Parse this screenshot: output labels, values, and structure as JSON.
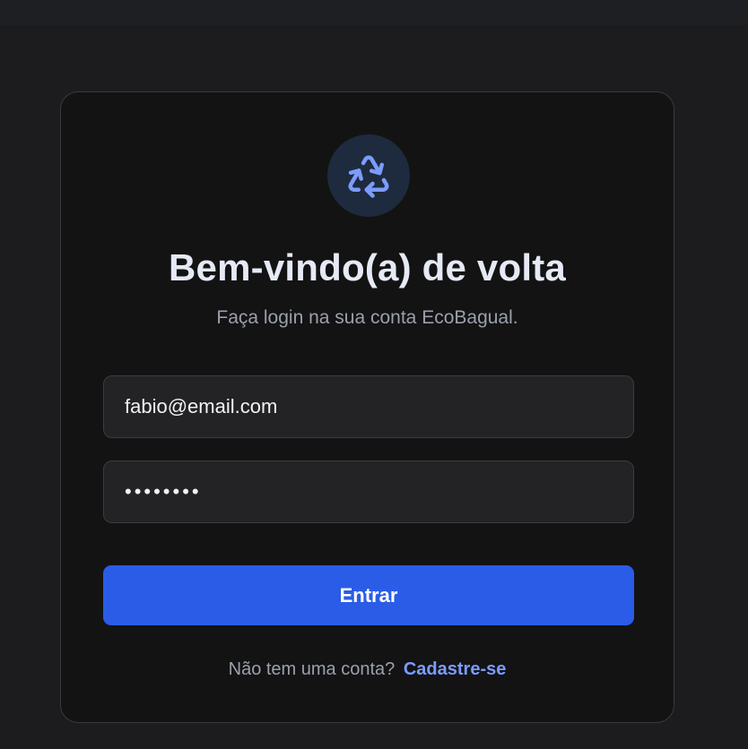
{
  "login": {
    "title": "Bem-vindo(a) de volta",
    "subtitle": "Faça login na sua conta EcoBagual.",
    "email_value": "fabio@email.com",
    "password_value": "••••••••",
    "submit_label": "Entrar",
    "signup_prompt": "Não tem uma conta?",
    "signup_link": "Cadastre-se",
    "logo_icon": "recycle-icon"
  },
  "colors": {
    "accent": "#2a5ce8",
    "link": "#7b9cff",
    "icon": "#7b9cff",
    "card_bg": "#131314",
    "page_bg": "#1c1c1e"
  }
}
